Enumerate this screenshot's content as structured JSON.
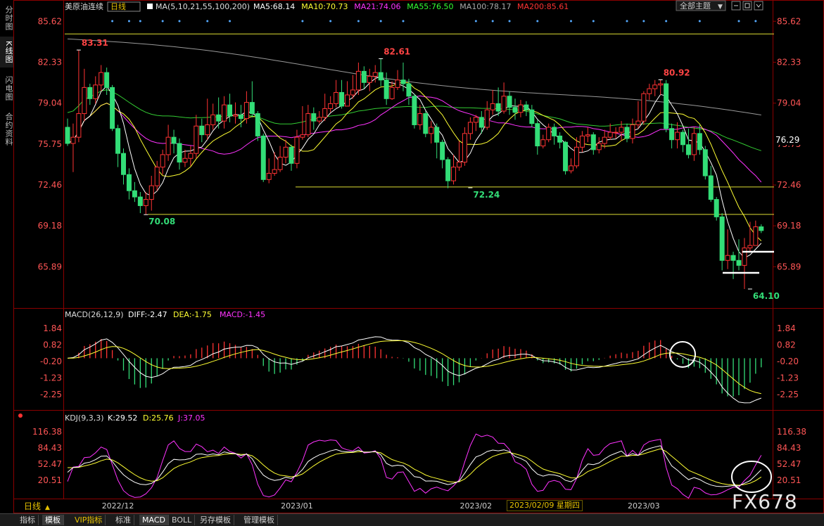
{
  "left_tabs": [
    {
      "label": "分时图",
      "active": false
    },
    {
      "label": "K线图",
      "active": true
    },
    {
      "label": "闪电图",
      "active": false
    },
    {
      "label": "合约资料",
      "active": false
    }
  ],
  "header": {
    "symbol": "美原油连续",
    "period": "日线",
    "ma_label": "MA(5,10,21,55,100,200)",
    "ma_values": [
      {
        "text": "MA5:68.14",
        "color": "#ffffff"
      },
      {
        "text": "MA10:70.73",
        "color": "#ffff33"
      },
      {
        "text": "MA21:74.06",
        "color": "#ff33ff"
      },
      {
        "text": "MA55:76.50",
        "color": "#33ff33"
      },
      {
        "text": "MA100:78.17",
        "color": "#aaaaaa"
      },
      {
        "text": "MA200:85.61",
        "color": "#ff3333"
      }
    ],
    "dropdown_label": "全部主题"
  },
  "macd_header": {
    "label": "MACD(26,12,9)",
    "diff": "DIFF:-2.47",
    "dea": "DEA:-1.75",
    "macd": "MACD:-1.45"
  },
  "kdj_header": {
    "label": "KDJ(9,3,3)",
    "k": "K:29.52",
    "d": "D:25.76",
    "j": "J:37.05"
  },
  "period_label": "日线",
  "x_axis_labels": [
    "2022/12",
    "2023/01",
    "2023/02",
    "2023/03"
  ],
  "highlight_date": "2023/02/09 星期四",
  "watermark": "FX678",
  "bottom_tabs": [
    {
      "label": "指标",
      "active": false,
      "vip": false
    },
    {
      "label": "模板",
      "active": true,
      "vip": false
    },
    {
      "label": "VIP指标",
      "active": false,
      "vip": true
    },
    {
      "label": "标准",
      "active": false,
      "vip": false
    },
    {
      "label": "MACD",
      "active": true,
      "vip": false
    },
    {
      "label": "BOLL",
      "active": false,
      "vip": false
    },
    {
      "label": "另存模板",
      "active": false,
      "vip": false
    },
    {
      "label": "管理模板",
      "active": false,
      "vip": false
    }
  ],
  "colors": {
    "up": "#ff3333",
    "down": "#33dd77",
    "ma5": "#ffffff",
    "ma10": "#ffff33",
    "ma21": "#ff33ff",
    "ma55": "#33cc33",
    "ma100": "#999999",
    "support": "#dddd33"
  },
  "chart_data": [
    {
      "type": "candlestick",
      "title": "美原油连续 日线",
      "y_ticks": [
        "85.62",
        "82.33",
        "79.04",
        "75.75",
        "72.46",
        "69.18",
        "65.89"
      ],
      "ylim": [
        62.8,
        86.2
      ],
      "current_price_label": "76.29",
      "price_annotations": [
        {
          "text": "83.31",
          "index": 2,
          "value": 83.31,
          "kind": "high"
        },
        {
          "text": "70.08",
          "index": 14,
          "value": 70.08,
          "kind": "low"
        },
        {
          "text": "82.61",
          "index": 56,
          "value": 82.61,
          "kind": "high"
        },
        {
          "text": "72.24",
          "index": 72,
          "value": 72.24,
          "kind": "low"
        },
        {
          "text": "80.92",
          "index": 106,
          "value": 80.92,
          "kind": "high"
        },
        {
          "text": "64.10",
          "index": 122,
          "value": 64.1,
          "kind": "low"
        }
      ],
      "horizontal_lines": [
        84.6,
        72.3,
        70.1
      ],
      "candles": [
        [
          77.1,
          75.8,
          77.8,
          75.6
        ],
        [
          75.8,
          76.3,
          77.4,
          73.5
        ],
        [
          76.3,
          78.2,
          83.3,
          75.9
        ],
        [
          78.2,
          80.3,
          81.8,
          77.6
        ],
        [
          80.3,
          79.4,
          80.6,
          78.9
        ],
        [
          79.4,
          80.5,
          81.2,
          79.0
        ],
        [
          80.5,
          81.5,
          82.1,
          80.0
        ],
        [
          81.5,
          80.3,
          81.9,
          79.7
        ],
        [
          80.3,
          77.0,
          80.5,
          76.8
        ],
        [
          77.0,
          75.0,
          77.3,
          73.9
        ],
        [
          75.0,
          73.3,
          75.4,
          72.5
        ],
        [
          73.3,
          72.0,
          73.8,
          71.3
        ],
        [
          72.0,
          71.5,
          72.7,
          71.1
        ],
        [
          71.5,
          70.8,
          71.9,
          70.2
        ],
        [
          70.8,
          71.3,
          71.9,
          70.1
        ],
        [
          71.3,
          72.4,
          73.2,
          70.4
        ],
        [
          72.4,
          73.9,
          74.4,
          72.0
        ],
        [
          73.9,
          74.9,
          75.3,
          73.3
        ],
        [
          74.9,
          76.3,
          77.3,
          74.4
        ],
        [
          76.3,
          75.8,
          76.9,
          75.0
        ],
        [
          75.8,
          74.3,
          76.2,
          73.7
        ],
        [
          74.3,
          74.6,
          75.3,
          73.9
        ],
        [
          74.6,
          75.0,
          75.6,
          74.0
        ],
        [
          75.0,
          77.2,
          78.1,
          74.6
        ],
        [
          77.2,
          76.5,
          77.8,
          75.9
        ],
        [
          76.5,
          77.3,
          79.4,
          76.1
        ],
        [
          77.3,
          78.1,
          79.0,
          76.9
        ],
        [
          78.1,
          77.6,
          79.5,
          77.0
        ],
        [
          77.6,
          78.9,
          79.6,
          77.0
        ],
        [
          78.9,
          78.0,
          79.8,
          77.5
        ],
        [
          78.0,
          78.1,
          79.1,
          77.4
        ],
        [
          78.1,
          77.8,
          78.9,
          77.1
        ],
        [
          77.8,
          79.1,
          80.0,
          77.4
        ],
        [
          79.1,
          78.2,
          80.8,
          77.9
        ],
        [
          78.2,
          76.4,
          78.4,
          76.0
        ],
        [
          76.4,
          72.9,
          76.6,
          72.7
        ],
        [
          72.9,
          73.4,
          74.6,
          72.6
        ],
        [
          73.4,
          73.7,
          75.1,
          73.2
        ],
        [
          73.7,
          74.7,
          75.6,
          73.5
        ],
        [
          74.7,
          75.5,
          76.1,
          74.2
        ],
        [
          75.5,
          74.2,
          75.7,
          73.6
        ],
        [
          74.2,
          76.3,
          76.9,
          73.8
        ],
        [
          76.3,
          76.5,
          78.8,
          76.1
        ],
        [
          76.5,
          78.2,
          78.9,
          76.3
        ],
        [
          78.2,
          77.6,
          78.7,
          76.9
        ],
        [
          77.6,
          77.9,
          78.4,
          77.4
        ],
        [
          77.9,
          78.6,
          79.8,
          77.6
        ],
        [
          78.6,
          79.0,
          79.6,
          78.3
        ],
        [
          79.0,
          79.9,
          80.9,
          78.7
        ],
        [
          79.9,
          78.8,
          80.9,
          78.6
        ],
        [
          78.8,
          79.7,
          80.8,
          79.2
        ],
        [
          79.7,
          80.1,
          81.3,
          79.4
        ],
        [
          80.1,
          81.6,
          82.3,
          79.7
        ],
        [
          81.6,
          80.7,
          82.0,
          80.2
        ],
        [
          80.7,
          81.2,
          81.8,
          80.0
        ],
        [
          81.2,
          81.5,
          82.1,
          80.7
        ],
        [
          81.5,
          80.9,
          82.6,
          80.4
        ],
        [
          80.9,
          79.4,
          81.5,
          78.9
        ],
        [
          79.4,
          80.3,
          80.8,
          79.3
        ],
        [
          80.3,
          80.9,
          81.7,
          80.1
        ],
        [
          80.9,
          80.6,
          82.3,
          80.0
        ],
        [
          80.6,
          79.6,
          81.0,
          78.9
        ],
        [
          79.6,
          77.3,
          79.8,
          77.0
        ],
        [
          77.3,
          78.2,
          78.9,
          76.9
        ],
        [
          78.2,
          76.6,
          78.4,
          76.3
        ],
        [
          76.6,
          77.1,
          77.6,
          75.8
        ],
        [
          77.1,
          75.9,
          77.4,
          74.6
        ],
        [
          75.9,
          74.5,
          76.1,
          73.8
        ],
        [
          74.5,
          72.8,
          74.7,
          72.2
        ],
        [
          72.8,
          73.9,
          74.9,
          72.5
        ],
        [
          73.9,
          74.3,
          76.0,
          73.6
        ],
        [
          74.3,
          76.6,
          77.1,
          74.0
        ],
        [
          76.6,
          77.5,
          77.9,
          76.1
        ],
        [
          77.5,
          77.9,
          78.1,
          76.8
        ],
        [
          77.9,
          77.1,
          78.4,
          76.6
        ],
        [
          77.1,
          78.5,
          79.2,
          76.9
        ],
        [
          78.5,
          79.0,
          80.1,
          78.1
        ],
        [
          79.0,
          78.4,
          80.3,
          78.0
        ],
        [
          78.4,
          79.6,
          80.7,
          78.2
        ],
        [
          79.6,
          78.7,
          80.0,
          78.1
        ],
        [
          78.7,
          78.3,
          79.4,
          77.7
        ],
        [
          78.3,
          78.9,
          79.3,
          77.9
        ],
        [
          78.9,
          78.5,
          79.2,
          78.0
        ],
        [
          78.5,
          77.4,
          78.9,
          77.1
        ],
        [
          77.4,
          75.6,
          77.7,
          74.9
        ],
        [
          75.6,
          76.1,
          76.5,
          75.4
        ],
        [
          76.1,
          77.1,
          77.4,
          75.9
        ],
        [
          77.1,
          76.4,
          77.4,
          75.7
        ],
        [
          76.4,
          75.9,
          76.7,
          75.4
        ],
        [
          75.9,
          73.6,
          76.0,
          73.3
        ],
        [
          73.6,
          74.0,
          74.6,
          73.4
        ],
        [
          74.0,
          75.5,
          76.3,
          73.8
        ],
        [
          75.5,
          76.4,
          76.8,
          75.1
        ],
        [
          76.4,
          76.5,
          77.1,
          75.9
        ],
        [
          76.5,
          75.3,
          76.7,
          74.9
        ],
        [
          75.3,
          75.8,
          76.3,
          75.0
        ],
        [
          75.8,
          76.3,
          76.9,
          75.4
        ],
        [
          76.3,
          76.7,
          77.4,
          76.1
        ],
        [
          76.7,
          76.7,
          77.1,
          76.2
        ],
        [
          76.7,
          77.1,
          77.6,
          76.0
        ],
        [
          77.1,
          76.2,
          77.4,
          75.9
        ],
        [
          76.2,
          77.3,
          77.8,
          75.8
        ],
        [
          77.3,
          77.6,
          79.2,
          77.0
        ],
        [
          77.6,
          79.8,
          80.0,
          77.3
        ],
        [
          79.8,
          80.2,
          80.6,
          79.3
        ],
        [
          80.2,
          80.5,
          80.9,
          79.6
        ],
        [
          80.5,
          80.6,
          80.9,
          79.7
        ],
        [
          80.6,
          77.0,
          80.9,
          76.7
        ],
        [
          77.0,
          76.1,
          77.4,
          75.4
        ],
        [
          76.1,
          76.7,
          77.5,
          75.4
        ],
        [
          76.7,
          75.7,
          76.9,
          75.1
        ],
        [
          75.7,
          74.9,
          77.0,
          74.6
        ],
        [
          74.9,
          76.6,
          77.1,
          74.4
        ],
        [
          76.6,
          75.3,
          77.3,
          74.9
        ],
        [
          75.3,
          73.2,
          75.6,
          72.9
        ],
        [
          73.2,
          71.3,
          74.0,
          71.1
        ],
        [
          71.3,
          69.9,
          71.5,
          69.6
        ],
        [
          69.9,
          66.4,
          70.2,
          65.6
        ],
        [
          66.4,
          66.8,
          68.9,
          65.7
        ],
        [
          66.8,
          66.4,
          67.1,
          64.9
        ],
        [
          66.4,
          66.0,
          68.1,
          65.6
        ],
        [
          66.0,
          67.4,
          68.2,
          64.1
        ],
        [
          67.4,
          67.6,
          69.5,
          67.1
        ],
        [
          67.6,
          69.1,
          69.6,
          68.0
        ],
        [
          69.1,
          68.8,
          69.3,
          68.6
        ]
      ]
    },
    {
      "type": "bar",
      "title": "MACD(26,12,9)",
      "y_ticks": [
        "1.84",
        "0.82",
        "-0.20",
        "-1.23",
        "-2.25"
      ],
      "ylim": [
        -2.9,
        2.5
      ],
      "diff_last": -2.47,
      "dea_last": -1.75,
      "macd_last": -1.45
    },
    {
      "type": "line",
      "title": "KDJ(9,3,3)",
      "y_ticks": [
        "116.38",
        "84.43",
        "52.47",
        "20.51"
      ],
      "ylim": [
        -10,
        130
      ],
      "k_last": 29.52,
      "d_last": 25.76,
      "j_last": 37.05
    }
  ]
}
